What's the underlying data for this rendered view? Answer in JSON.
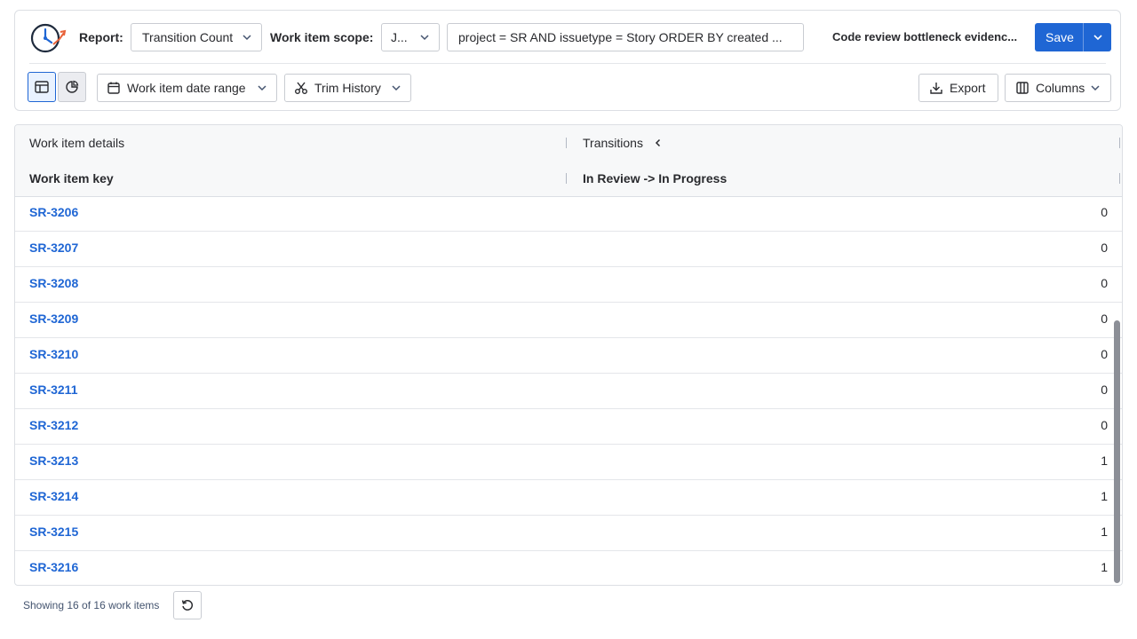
{
  "toolbar": {
    "report_label": "Report:",
    "report_value": "Transition Count",
    "scope_label": "Work item scope:",
    "scope_value": "J...",
    "jql_value": "project = SR AND issuetype = Story ORDER BY created ...",
    "report_name": "Code review bottleneck evidenc...",
    "save_label": "Save",
    "date_range_label": "Work item date range",
    "trim_history_label": "Trim History",
    "export_label": "Export",
    "columns_label": "Columns"
  },
  "table": {
    "group_headers": {
      "details": "Work item details",
      "transitions": "Transitions"
    },
    "columns": {
      "key": "Work item key",
      "transition": "In Review -> In Progress"
    },
    "rows": [
      {
        "key": "SR-3206",
        "count": "0"
      },
      {
        "key": "SR-3207",
        "count": "0"
      },
      {
        "key": "SR-3208",
        "count": "0"
      },
      {
        "key": "SR-3209",
        "count": "0"
      },
      {
        "key": "SR-3210",
        "count": "0"
      },
      {
        "key": "SR-3211",
        "count": "0"
      },
      {
        "key": "SR-3212",
        "count": "0"
      },
      {
        "key": "SR-3213",
        "count": "1"
      },
      {
        "key": "SR-3214",
        "count": "1"
      },
      {
        "key": "SR-3215",
        "count": "1"
      },
      {
        "key": "SR-3216",
        "count": "1"
      }
    ]
  },
  "footer": {
    "status": "Showing 16 of 16 work items"
  },
  "colors": {
    "accent": "#1f66d4",
    "link": "#1f66d4",
    "border": "#dcdfe4"
  }
}
